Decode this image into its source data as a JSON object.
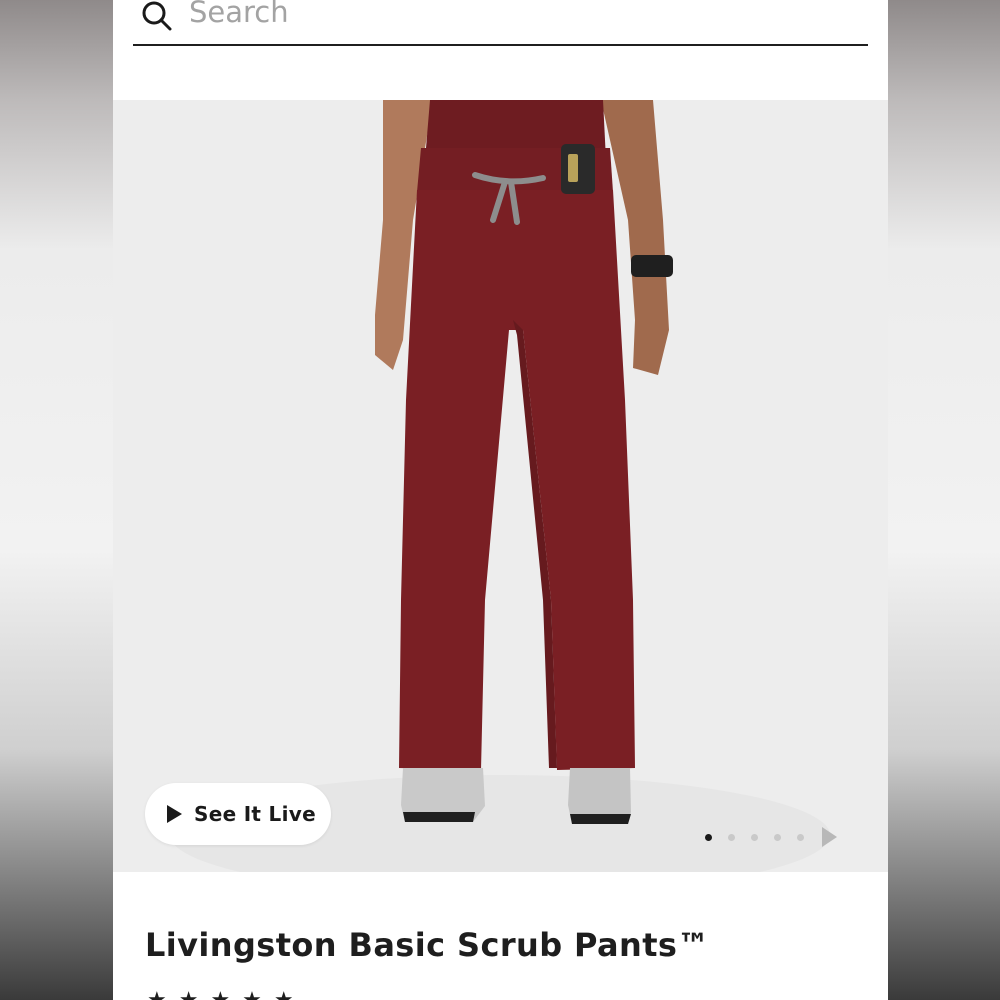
{
  "search": {
    "placeholder": "Search"
  },
  "product": {
    "title": "Livingston Basic Scrub Pants™",
    "color": "#7a1f24",
    "rating_stars": "★★★★★"
  },
  "media": {
    "see_it_live_label": "See It Live",
    "carousel_total": 5,
    "carousel_active": 1
  },
  "colors": {
    "accent": "#1a1a1a",
    "pants": "#7a1f24",
    "background": "#ededed"
  }
}
